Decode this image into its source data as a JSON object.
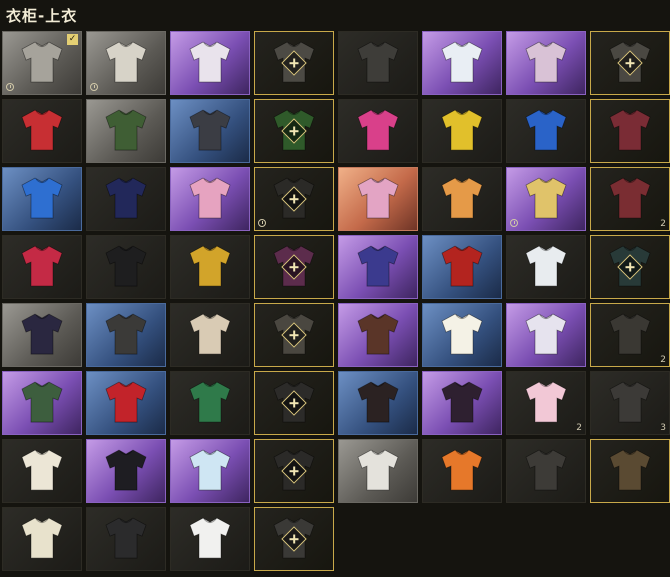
{
  "header": {
    "title": "衣柜-上衣"
  },
  "colors": {
    "accent_gold": "#c8a94a",
    "background": "#15140f"
  },
  "icons": {
    "equipped": "checkmark-icon",
    "timed": "clock-icon",
    "empty_slot": "plus-icon"
  },
  "items": [
    {
      "bg": "grey",
      "shirt": "#a6a39b",
      "equipped": true,
      "timed": true,
      "count": ""
    },
    {
      "bg": "grey",
      "shirt": "#d7d3c8",
      "timed": true,
      "count": ""
    },
    {
      "bg": "purple",
      "shirt": "#e9e3ec",
      "count": ""
    },
    {
      "bg": "gold",
      "slot": true,
      "shirt": "#4c4a44",
      "count": ""
    },
    {
      "bg": "dark",
      "shirt": "#3e3d39",
      "count": ""
    },
    {
      "bg": "purple",
      "shirt": "#e9eef4",
      "count": ""
    },
    {
      "bg": "purple",
      "shirt": "#d9c2d6",
      "count": ""
    },
    {
      "bg": "gold",
      "slot": true,
      "shirt": "#4a4842",
      "count": ""
    },
    {
      "bg": "dark",
      "shirt": "#c72f33",
      "count": ""
    },
    {
      "bg": "grey",
      "shirt": "#3f5e34",
      "count": ""
    },
    {
      "bg": "blue",
      "shirt": "#3b3d44",
      "count": ""
    },
    {
      "bg": "gold",
      "slot": true,
      "shirt": "#2f5a2a",
      "count": ""
    },
    {
      "bg": "dark",
      "shirt": "#d9408a",
      "count": ""
    },
    {
      "bg": "dark",
      "shirt": "#e1c02b",
      "count": ""
    },
    {
      "bg": "dark",
      "shirt": "#2a63c8",
      "count": ""
    },
    {
      "bg": "gold",
      "slot": false,
      "shirt": "#7a2c35",
      "count": ""
    },
    {
      "bg": "blue",
      "shirt": "#2e6fd1",
      "count": ""
    },
    {
      "bg": "dark",
      "shirt": "#22285a",
      "count": ""
    },
    {
      "bg": "purple",
      "shirt": "#e6a3c0",
      "count": ""
    },
    {
      "bg": "gold",
      "slot": true,
      "shirt": "#2b2a27",
      "timed": true,
      "count": ""
    },
    {
      "bg": "orange",
      "shirt": "#e3a4c4",
      "count": ""
    },
    {
      "bg": "dark",
      "shirt": "#e59a48",
      "count": ""
    },
    {
      "bg": "purple",
      "shirt": "#e0c36a",
      "timed": true,
      "count": ""
    },
    {
      "bg": "gold",
      "slot": false,
      "shirt": "#7a2d32",
      "count": "2"
    },
    {
      "bg": "dark",
      "shirt": "#c42a45",
      "count": ""
    },
    {
      "bg": "dark",
      "shirt": "#1e1e1f",
      "count": ""
    },
    {
      "bg": "dark",
      "shirt": "#d2a42a",
      "count": ""
    },
    {
      "bg": "gold",
      "slot": true,
      "shirt": "#5c2c4c",
      "count": ""
    },
    {
      "bg": "purple",
      "shirt": "#3b3a8e",
      "count": ""
    },
    {
      "bg": "blue",
      "shirt": "#b3241f",
      "count": ""
    },
    {
      "bg": "dark",
      "shirt": "#e8ecef",
      "count": ""
    },
    {
      "bg": "gold",
      "slot": true,
      "shirt": "#283a38",
      "count": ""
    },
    {
      "bg": "grey",
      "shirt": "#2a2740",
      "count": ""
    },
    {
      "bg": "blue",
      "shirt": "#3b3a38",
      "count": ""
    },
    {
      "bg": "dark",
      "shirt": "#d9cbb4",
      "count": ""
    },
    {
      "bg": "gold",
      "slot": true,
      "shirt": "#4a4740",
      "count": ""
    },
    {
      "bg": "purple",
      "shirt": "#5a3528",
      "count": ""
    },
    {
      "bg": "blue",
      "shirt": "#f4f2e6",
      "count": ""
    },
    {
      "bg": "purple",
      "shirt": "#e6e3ee",
      "count": ""
    },
    {
      "bg": "gold",
      "slot": false,
      "shirt": "#3a3833",
      "count": "2"
    },
    {
      "bg": "purple",
      "shirt": "#3d5e3e",
      "count": ""
    },
    {
      "bg": "blue",
      "shirt": "#c2232a",
      "count": ""
    },
    {
      "bg": "dark",
      "shirt": "#2f7a4a",
      "count": ""
    },
    {
      "bg": "gold",
      "slot": true,
      "shirt": "#2c2b29",
      "count": ""
    },
    {
      "bg": "blue",
      "shirt": "#2b2222",
      "count": ""
    },
    {
      "bg": "purple",
      "shirt": "#2e2030",
      "count": ""
    },
    {
      "bg": "dark",
      "shirt": "#f2c8d6",
      "count": "2"
    },
    {
      "bg": "dark",
      "shirt": "#3c3a37",
      "count": "3"
    },
    {
      "bg": "dark",
      "shirt": "#ece6d6",
      "count": ""
    },
    {
      "bg": "purple",
      "shirt": "#1e1d22",
      "count": ""
    },
    {
      "bg": "purple",
      "shirt": "#cfe6f3",
      "count": ""
    },
    {
      "bg": "gold",
      "slot": true,
      "shirt": "#2b2a28",
      "count": ""
    },
    {
      "bg": "grey",
      "shirt": "#e4e2dc",
      "count": ""
    },
    {
      "bg": "dark",
      "shirt": "#e6782a",
      "count": ""
    },
    {
      "bg": "dark",
      "shirt": "#3d3b37",
      "count": ""
    },
    {
      "bg": "gold",
      "slot": false,
      "shirt": "#5a4a32",
      "count": ""
    },
    {
      "bg": "dark",
      "shirt": "#e8e2cc",
      "count": ""
    },
    {
      "bg": "dark",
      "shirt": "#2b2b2c",
      "count": ""
    },
    {
      "bg": "dark",
      "shirt": "#f1f1ef",
      "count": ""
    },
    {
      "bg": "gold",
      "slot": true,
      "shirt": "#3a3936",
      "count": ""
    }
  ]
}
